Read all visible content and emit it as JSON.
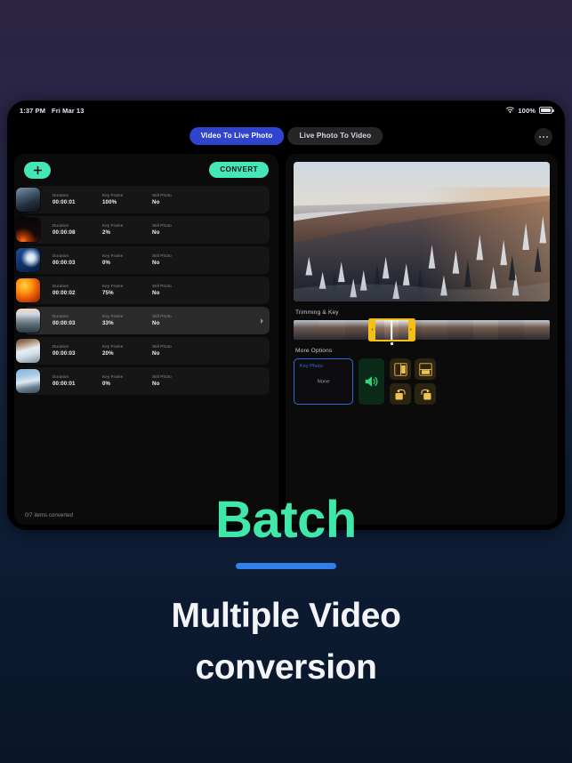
{
  "status_bar": {
    "time": "1:37 PM",
    "date": "Fri Mar 13",
    "battery_percent": "100%",
    "wifi_icon": "wifi-icon",
    "battery_icon": "battery-icon"
  },
  "nav": {
    "segments": [
      {
        "label": "Video To Live Photo",
        "active": true
      },
      {
        "label": "Live Photo To Video",
        "active": false
      }
    ],
    "more_icon": "ellipsis-icon"
  },
  "left_panel": {
    "add_label": "+",
    "add_icon": "plus-icon",
    "convert_label": "CONVERT",
    "column_labels": {
      "duration": "Duration",
      "key_frame": "Key Frame",
      "still_photo": "Still Photo"
    },
    "items": [
      {
        "duration": "00:00:01",
        "key_frame": "100%",
        "still_photo": "No",
        "selected": false
      },
      {
        "duration": "00:00:08",
        "key_frame": "2%",
        "still_photo": "No",
        "selected": false
      },
      {
        "duration": "00:00:03",
        "key_frame": "0%",
        "still_photo": "No",
        "selected": false
      },
      {
        "duration": "00:00:02",
        "key_frame": "75%",
        "still_photo": "No",
        "selected": false
      },
      {
        "duration": "00:00:03",
        "key_frame": "33%",
        "still_photo": "No",
        "selected": true
      },
      {
        "duration": "00:00:03",
        "key_frame": "20%",
        "still_photo": "No",
        "selected": false
      },
      {
        "duration": "00:00:01",
        "key_frame": "0%",
        "still_photo": "No",
        "selected": false
      }
    ],
    "status": "0/7 items converted"
  },
  "right_panel": {
    "preview_alt": "aerial snowy pine forest at sunset",
    "trimming_title": "Trimming & Key",
    "more_options_title": "More Options",
    "key_photo": {
      "label": "Key Photo",
      "value": "None"
    },
    "tools": [
      {
        "name": "volume-icon",
        "label": "Volume"
      },
      {
        "name": "flip-horizontal-icon",
        "label": "Flip Horizontal"
      },
      {
        "name": "flip-vertical-icon",
        "label": "Flip Vertical"
      },
      {
        "name": "rotate-left-icon",
        "label": "Rotate Left"
      },
      {
        "name": "rotate-right-icon",
        "label": "Rotate Right"
      }
    ]
  },
  "promo": {
    "headline": "Batch",
    "subhead_line1": "Multiple Video",
    "subhead_line2": "conversion"
  },
  "colors": {
    "accent_mint": "#45e6b8",
    "accent_blue": "#2f45d0",
    "rule_blue": "#2f80ed",
    "headline_green": "#3fe8a8",
    "trim_yellow": "#f5bf14"
  }
}
